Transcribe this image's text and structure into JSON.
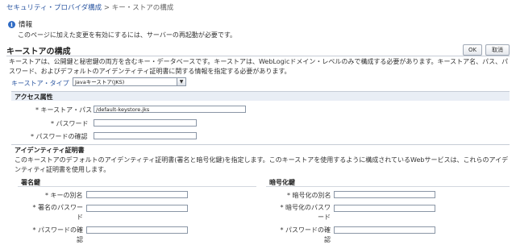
{
  "breadcrumb": {
    "link": "セキュリティ・プロバイダ構成",
    "separator": ">",
    "current": "キー・ストアの構成"
  },
  "info": {
    "title": "情報",
    "message": "このページに加えた変更を有効にするには、サーバーの再起動が必要です。"
  },
  "page": {
    "title": "キーストアの構成",
    "description": "キーストアは、公開鍵と秘密鍵の両方を含むキー・データベースです。キーストアは、WebLogicドメイン・レベルのみで構成する必要があります。キーストア名、パス、パスワード、およびデフォルトのアイデンティティ証明書に関する情報を指定する必要があります。"
  },
  "buttons": {
    "ok": "OK",
    "cancel": "取消"
  },
  "keystore_type": {
    "label": "キーストア・タイプ",
    "value": "Javaキーストア(JKS)"
  },
  "access": {
    "heading": "アクセス属性",
    "path_label": "キーストア・パス",
    "path_value": "/default-keystore.jks",
    "password_label": "パスワード",
    "confirm_label": "パスワードの確認"
  },
  "identity": {
    "heading": "アイデンティティ証明書",
    "description": "このキーストアのデフォルトのアイデンティティ証明書(署名と暗号化鍵)を指定します。このキーストアを使用するように構成されているWebサービスは、これらのアイデンティティ証明書を使用します。",
    "signing": {
      "heading": "署名鍵",
      "alias_label": "キーの別名",
      "password_label": "署名のパスワード",
      "confirm_label": "パスワードの確認"
    },
    "encryption": {
      "heading": "暗号化鍵",
      "alias_label": "暗号化の別名",
      "password_label": "暗号化のパスワード",
      "confirm_label": "パスワードの確認"
    }
  },
  "required_marker": "*",
  "icons": {
    "info": "info-icon",
    "dropdown": "chevron-down-icon"
  },
  "colors": {
    "link": "#2b56a1",
    "section_bg": "#e9eef5",
    "info_icon": "#2f6bc4"
  }
}
